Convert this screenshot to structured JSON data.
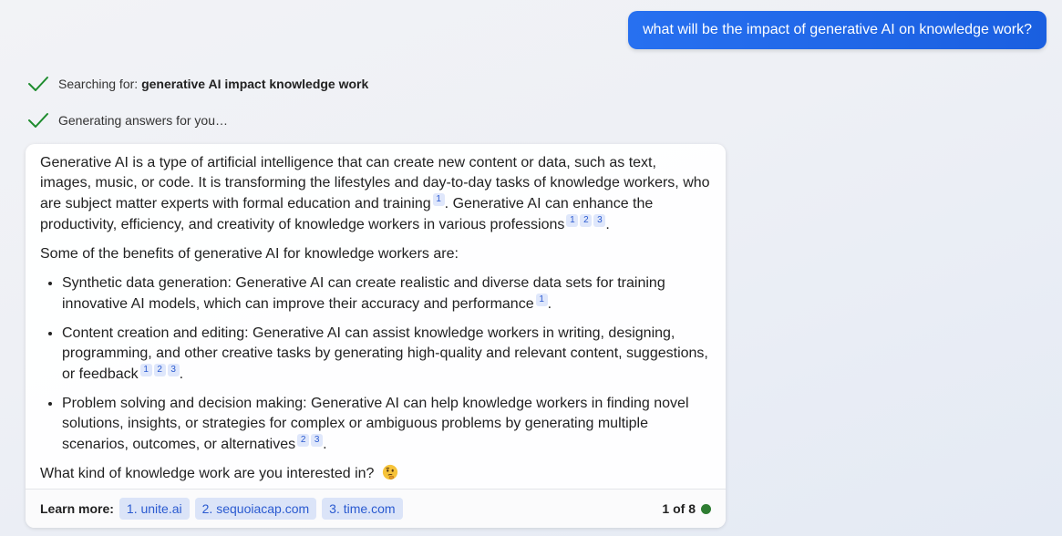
{
  "user_message": "what will be the impact of generative AI on knowledge work?",
  "status": {
    "searching_prefix": "Searching for: ",
    "searching_query": "generative AI impact knowledge work",
    "generating": "Generating answers for you…"
  },
  "answer": {
    "p1_a": "Generative AI is a type of artificial intelligence that can create new content or data, such as text, images, music, or code. It is transforming the lifestyles and day-to-day tasks of knowledge workers, who are subject matter experts with formal education and training",
    "p1_b": ". Generative AI can enhance the productivity, efficiency, and creativity of knowledge workers in various professions",
    "p2": "Some of the benefits of generative AI for knowledge workers are:",
    "bullets": [
      "Synthetic data generation: Generative AI can create realistic and diverse data sets for training innovative AI models, which can improve their accuracy and performance",
      "Content creation and editing: Generative AI can assist knowledge workers in writing, designing, programming, and other creative tasks by generating high-quality and relevant content, suggestions, or feedback",
      "Problem solving and decision making: Generative AI can help knowledge workers in finding novel solutions, insights, or strategies for complex or ambiguous problems by generating multiple scenarios, outcomes, or alternatives"
    ],
    "period": ".",
    "question": "What kind of knowledge work are you interested in?",
    "citations": {
      "c1": "1",
      "c2": "2",
      "c3": "3"
    }
  },
  "learn_more": {
    "label": "Learn more:",
    "sources": [
      "1. unite.ai",
      "2. sequoiacap.com",
      "3. time.com"
    ],
    "page_count": "1 of 8"
  },
  "colors": {
    "user_bubble": "#1a5fe0",
    "check": "#1e8c2e",
    "citation_bg": "#dfe7fb",
    "status_dot": "#2e7d32"
  },
  "icons": {
    "check": "check-icon",
    "emoji": "thinking-face-icon"
  }
}
